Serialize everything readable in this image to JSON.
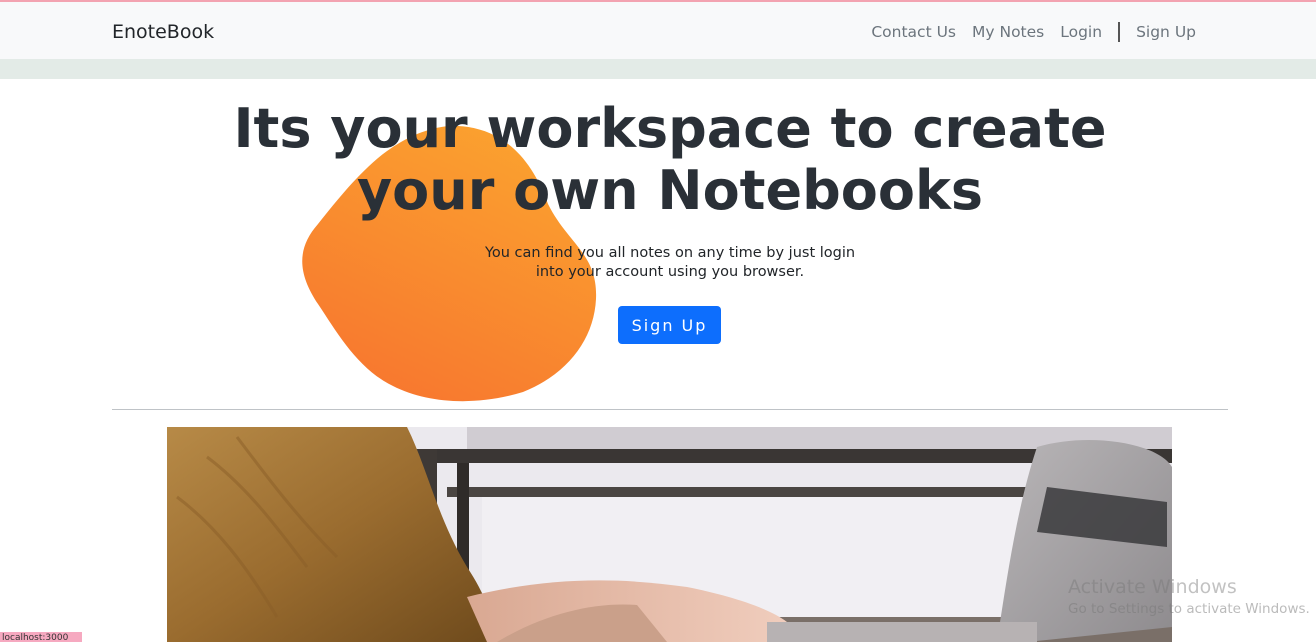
{
  "navbar": {
    "brand": "EnoteBook",
    "links": [
      {
        "label": "Contact Us"
      },
      {
        "label": "My Notes"
      },
      {
        "label": "Login"
      },
      {
        "label": "Sign Up"
      }
    ]
  },
  "hero": {
    "title": "Its your workspace to create your own Notebooks",
    "text": "You can find you all notes on any time by just login into your account using you browser.",
    "button_label": "Sign Up"
  },
  "watermark": {
    "title": "Activate Windows",
    "subtitle": "Go to Settings to activate Windows."
  },
  "corner_tag": "localhost:3000",
  "colors": {
    "accent": "#0d6efd",
    "blob_start": "#fba22f",
    "blob_end": "#f7752f",
    "navbar_bg": "#f8f9fa"
  }
}
